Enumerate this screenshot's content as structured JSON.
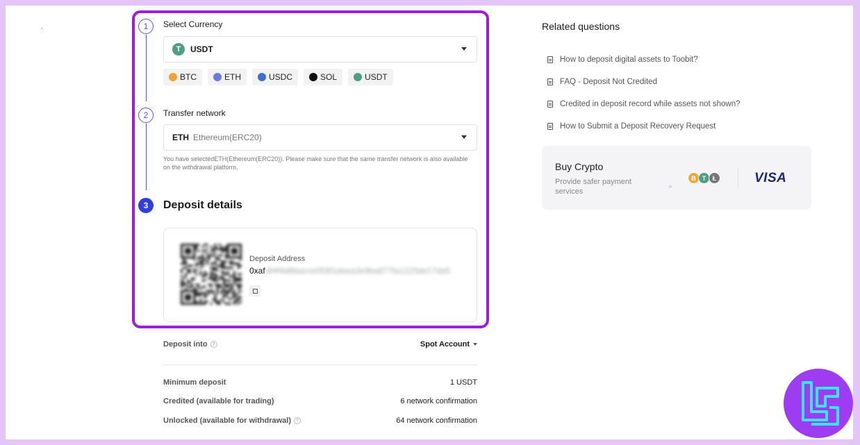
{
  "steps": {
    "one": {
      "number": "1",
      "label": "Select Currency"
    },
    "two": {
      "number": "2",
      "label": "Transfer network"
    },
    "three": {
      "number": "3",
      "label": "Deposit details"
    }
  },
  "currency": {
    "selected_icon": "T",
    "selected": "USDT",
    "chips": [
      {
        "label": "BTC",
        "color": "#f3a03a",
        "icon": "btc-coin-icon"
      },
      {
        "label": "ETH",
        "color": "#6a7be0",
        "icon": "eth-coin-icon"
      },
      {
        "label": "USDC",
        "color": "#3f6fd0",
        "icon": "usdc-coin-icon"
      },
      {
        "label": "SOL",
        "color": "#111111",
        "icon": "sol-coin-icon"
      },
      {
        "label": "USDT",
        "color": "#4e9e85",
        "icon": "usdt-coin-icon"
      }
    ]
  },
  "network": {
    "code": "ETH",
    "name": "Ethereum(ERC20)",
    "note": "You have selectedETH(Ethereum(ERC20)). Please make sure that the same transfer network is also available on the withdrawal platform."
  },
  "deposit": {
    "address_label": "Deposit Address",
    "address_prefix": "0xaf",
    "address_blurred": "8f4f4d8bacce059f1deea3e9ba877fa1223de17da5"
  },
  "details": {
    "deposit_into_label": "Deposit into",
    "deposit_into_value": "Spot Account",
    "min_deposit_label": "Minimum deposit",
    "min_deposit_value": "1 USDT",
    "credited_label": "Credited (available for trading)",
    "credited_value": "6 network confirmation",
    "unlocked_label": "Unlocked (available for withdrawal)",
    "unlocked_value": "64 network confirmation"
  },
  "related": {
    "title": "Related questions",
    "items": [
      "How to deposit digital assets to Toobit?",
      "FAQ - Deposit Not Credited",
      "Credited in deposit record while assets not shown?",
      "How to Submit a Deposit Recovery Request"
    ]
  },
  "buy": {
    "title": "Buy Crypto",
    "subtitle": "Provide safer payment services",
    "arrow": ">",
    "coins": [
      {
        "letter": "B",
        "color": "#f0a73a"
      },
      {
        "letter": "T",
        "color": "#4e9e85"
      },
      {
        "letter": "Ł",
        "color": "#777777"
      }
    ],
    "visa": "VISA"
  },
  "colors": {
    "frame": "#9b1fd6",
    "step": "#2f3fd9",
    "logo": "#9d3cf0"
  }
}
